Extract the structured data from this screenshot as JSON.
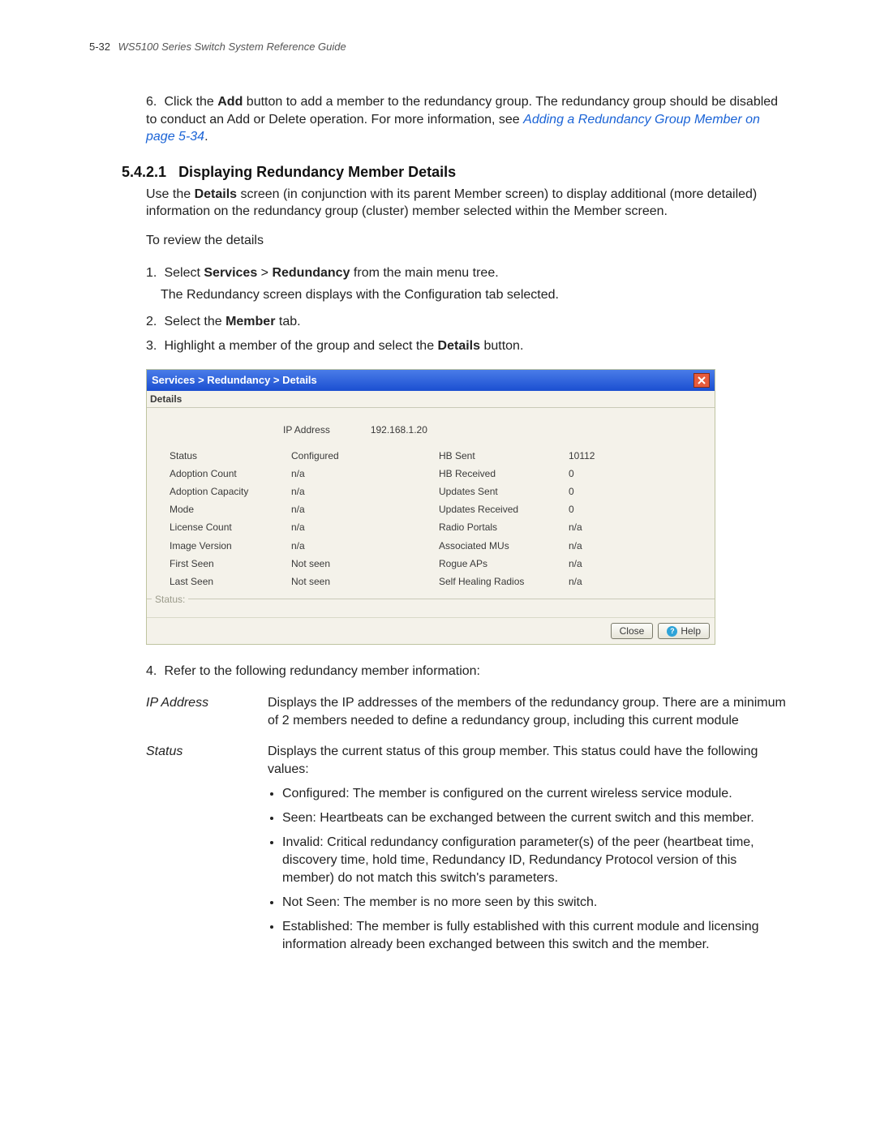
{
  "header": {
    "pagenum": "5-32",
    "title": "WS5100 Series Switch System Reference Guide"
  },
  "step6": {
    "num": "6.",
    "text_a": "Click the ",
    "bold1": "Add",
    "text_b": " button to add a member to the redundancy group. The redundancy group should be disabled to conduct an Add or Delete operation. For more information, see ",
    "link": "Adding a Redundancy Group Member on page 5-34",
    "period": "."
  },
  "section": {
    "num": "5.4.2.1",
    "title": "Displaying Redundancy Member Details"
  },
  "intro": {
    "a": "Use the ",
    "bold": "Details",
    "b": " screen (in conjunction with its parent Member screen) to display additional (more detailed) information on the redundancy group (cluster) member selected within the Member screen."
  },
  "review": "To review the details",
  "steps": {
    "s1_num": "1.",
    "s1_a": "Select ",
    "s1_b1": "Services",
    "s1_gt": " > ",
    "s1_b2": "Redundancy",
    "s1_c": " from the main menu tree.",
    "s1_sub": "The Redundancy screen displays with the Configuration tab selected.",
    "s2_num": "2.",
    "s2_a": "Select the ",
    "s2_b": "Member",
    "s2_c": " tab.",
    "s3_num": "3.",
    "s3_a": "Highlight a member of the group and select the ",
    "s3_b": "Details",
    "s3_c": " button."
  },
  "dialog": {
    "title": "Services > Redundancy > Details",
    "tab": "Details",
    "ip_label": "IP Address",
    "ip_value": "192.168.1.20",
    "left": [
      {
        "k": "Status",
        "v": "Configured"
      },
      {
        "k": "Adoption Count",
        "v": "n/a"
      },
      {
        "k": "Adoption Capacity",
        "v": "n/a"
      },
      {
        "k": "Mode",
        "v": "n/a"
      },
      {
        "k": "License Count",
        "v": "n/a"
      },
      {
        "k": "Image Version",
        "v": "n/a"
      },
      {
        "k": "First Seen",
        "v": "Not seen"
      },
      {
        "k": "Last Seen",
        "v": "Not seen"
      }
    ],
    "right": [
      {
        "k": "HB Sent",
        "v": "10112"
      },
      {
        "k": "HB Received",
        "v": "0"
      },
      {
        "k": "Updates Sent",
        "v": "0"
      },
      {
        "k": "Updates Received",
        "v": "0"
      },
      {
        "k": "Radio Portals",
        "v": "n/a"
      },
      {
        "k": "Associated MUs",
        "v": "n/a"
      },
      {
        "k": "Rogue APs",
        "v": "n/a"
      },
      {
        "k": "Self Healing Radios",
        "v": "n/a"
      }
    ],
    "status_label": "Status:",
    "close": "Close",
    "help": "Help"
  },
  "step4": {
    "num": "4.",
    "text": "Refer to the following redundancy member information:"
  },
  "defs": {
    "ip_term": "IP Address",
    "ip_body": "Displays the IP addresses of the members of the redundancy group. There are a minimum of 2 members needed to define a redundancy group, including this current module",
    "status_term": "Status",
    "status_body": "Displays the current status of this group member. This status could have the following values:",
    "status_bullets": [
      "Configured: The member is configured on the current wireless service module.",
      "Seen: Heartbeats can be exchanged between the current switch and this member.",
      "Invalid: Critical redundancy configuration parameter(s) of the peer (heartbeat time, discovery time, hold time, Redundancy ID, Redundancy Protocol version of this member) do not match this switch's parameters.",
      "Not Seen: The member is no more seen by this switch.",
      "Established: The member is fully established with this current module and licensing information already been exchanged between this switch and the member."
    ]
  }
}
